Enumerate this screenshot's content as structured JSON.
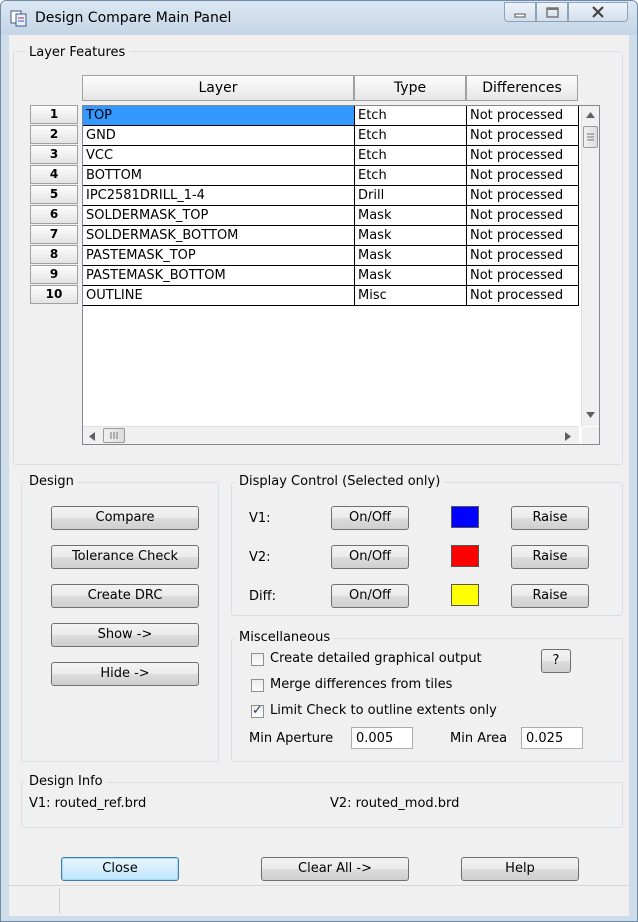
{
  "window": {
    "title": "Design Compare Main Panel"
  },
  "layer_features": {
    "label": "Layer Features",
    "columns": [
      "Layer",
      "Type",
      "Differences"
    ],
    "rows": [
      {
        "num": "1",
        "layer": "TOP",
        "type": "Etch",
        "diff": "Not processed"
      },
      {
        "num": "2",
        "layer": "GND",
        "type": "Etch",
        "diff": "Not processed"
      },
      {
        "num": "3",
        "layer": "VCC",
        "type": "Etch",
        "diff": "Not processed"
      },
      {
        "num": "4",
        "layer": "BOTTOM",
        "type": "Etch",
        "diff": "Not processed"
      },
      {
        "num": "5",
        "layer": "IPC2581DRILL_1-4",
        "type": "Drill",
        "diff": "Not processed"
      },
      {
        "num": "6",
        "layer": "SOLDERMASK_TOP",
        "type": "Mask",
        "diff": "Not processed"
      },
      {
        "num": "7",
        "layer": "SOLDERMASK_BOTTOM",
        "type": "Mask",
        "diff": "Not processed"
      },
      {
        "num": "8",
        "layer": "PASTEMASK_TOP",
        "type": "Mask",
        "diff": "Not processed"
      },
      {
        "num": "9",
        "layer": "PASTEMASK_BOTTOM",
        "type": "Mask",
        "diff": "Not processed"
      },
      {
        "num": "10",
        "layer": "OUTLINE",
        "type": "Misc",
        "diff": "Not processed"
      }
    ]
  },
  "design": {
    "label": "Design",
    "compare": "Compare",
    "tolerance_check": "Tolerance Check",
    "create_drc": "Create DRC",
    "show": "Show ->",
    "hide": "Hide ->"
  },
  "display_control": {
    "label": "Display Control (Selected only)",
    "v1": {
      "label": "V1:",
      "toggle": "On/Off",
      "color": "#0000ff",
      "raise": "Raise"
    },
    "v2": {
      "label": "V2:",
      "toggle": "On/Off",
      "color": "#ff0000",
      "raise": "Raise"
    },
    "diff": {
      "label": "Diff:",
      "toggle": "On/Off",
      "color": "#ffff00",
      "raise": "Raise"
    }
  },
  "misc": {
    "label": "Miscellaneous",
    "opt1": {
      "label": "Create detailed graphical output",
      "checked": false
    },
    "opt2": {
      "label": "Merge differences from tiles",
      "checked": false
    },
    "opt3": {
      "label": "Limit Check to outline extents only",
      "checked": true
    },
    "help_q": "?",
    "min_aperture_label": "Min Aperture",
    "min_aperture": "0.005",
    "min_area_label": "Min Area",
    "min_area": "0.025"
  },
  "design_info": {
    "label": "Design Info",
    "v1": "V1:  routed_ref.brd",
    "v2": "V2:  routed_mod.brd"
  },
  "footer": {
    "close": "Close",
    "clear_all": "Clear All ->",
    "help": "Help"
  },
  "colors": {
    "selection": "#3399ff"
  }
}
